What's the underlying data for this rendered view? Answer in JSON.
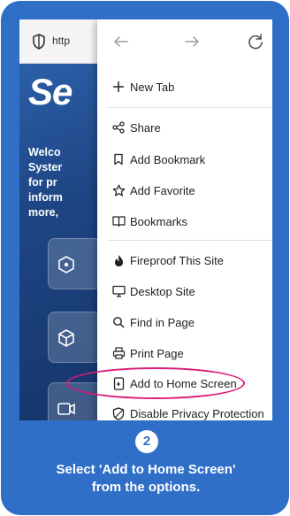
{
  "browser": {
    "url_text": "http",
    "nav": {
      "back_icon": "arrow-left-icon",
      "forward_icon": "arrow-right-icon",
      "reload_icon": "reload-icon"
    }
  },
  "page": {
    "hero_text": "Se",
    "paragraph": "Welco\nSyster\nfor pr\ninform\nmore,"
  },
  "menu": {
    "items": [
      {
        "label": "New Tab",
        "icon": "plus-icon"
      },
      {
        "label": "Share",
        "icon": "share-icon"
      },
      {
        "label": "Add Bookmark",
        "icon": "bookmark-icon"
      },
      {
        "label": "Add Favorite",
        "icon": "star-icon"
      },
      {
        "label": "Bookmarks",
        "icon": "book-icon"
      },
      {
        "label": "Fireproof This Site",
        "icon": "fire-icon"
      },
      {
        "label": "Desktop Site",
        "icon": "monitor-icon"
      },
      {
        "label": "Find in Page",
        "icon": "search-icon"
      },
      {
        "label": "Print Page",
        "icon": "printer-icon"
      },
      {
        "label": "Add to Home Screen",
        "icon": "add-to-home-icon"
      },
      {
        "label": "Disable Privacy Protection",
        "icon": "shield-off-icon"
      }
    ]
  },
  "step": {
    "number": "2",
    "instruction_line1": "Select 'Add to Home Screen'",
    "instruction_line2": "from the options."
  },
  "colors": {
    "card_background": "#2f6fc8",
    "highlight_ring": "#d81b7a",
    "menu_background": "#ffffff"
  }
}
